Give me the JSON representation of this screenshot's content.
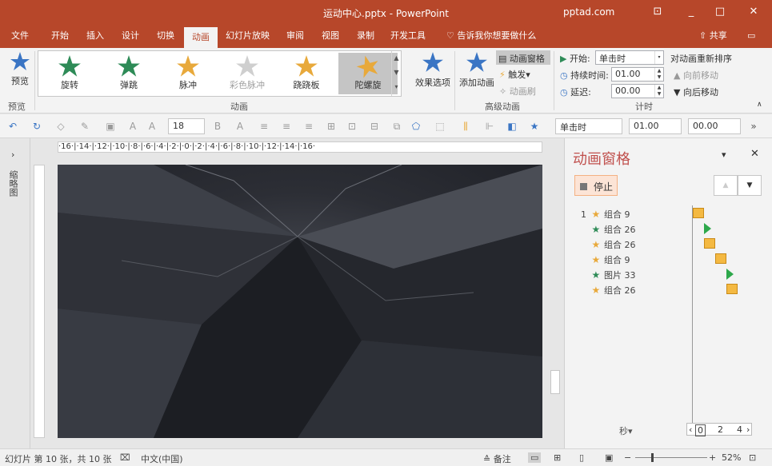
{
  "window": {
    "title": "运动中心.pptx - PowerPoint",
    "brand": "pptad.com",
    "minimize": "_",
    "maximize": "□",
    "close": "✕"
  },
  "tabs": [
    {
      "label": "文件"
    },
    {
      "label": "开始"
    },
    {
      "label": "插入"
    },
    {
      "label": "设计"
    },
    {
      "label": "切换"
    },
    {
      "label": "动画"
    },
    {
      "label": "幻灯片放映"
    },
    {
      "label": "审阅"
    },
    {
      "label": "视图"
    },
    {
      "label": "录制"
    },
    {
      "label": "开发工具"
    },
    {
      "label": "告诉我你想要做什么"
    }
  ],
  "share_label": "共享",
  "ribbon": {
    "preview_label": "预览",
    "preview_group": "预览",
    "animations": [
      {
        "label": "旋转",
        "color": "#2e8b57"
      },
      {
        "label": "弹跳",
        "color": "#2e8b57"
      },
      {
        "label": "脉冲",
        "color": "#e8a93b"
      },
      {
        "label": "彩色脉冲",
        "color": "#c8c8c8"
      },
      {
        "label": "跷跷板",
        "color": "#e8a93b"
      },
      {
        "label": "陀螺旋",
        "color": "#e8a93b"
      }
    ],
    "animation_group": "动画",
    "effect_options": "效果选项",
    "add_animation": "添加动画",
    "animation_pane": "动画窗格",
    "trigger": "触发",
    "animation_painter": "动画刷",
    "advanced_group": "高级动画",
    "start_label": "开始:",
    "start_value": "单击时",
    "duration_label": "持续时间:",
    "duration_value": "01.00",
    "delay_label": "延迟:",
    "delay_value": "00.00",
    "timing_group": "计时",
    "reorder_label": "对动画重新排序",
    "move_earlier": "向前移动",
    "move_later": "向后移动"
  },
  "toolbar2": {
    "font_size": "18",
    "start_value": "单击时",
    "duration_value": "01.00",
    "delay_value": "00.00"
  },
  "thumbnails_label": "缩略图",
  "ruler": {
    "h_labels": "·16·|·14·|·12·|·10·|·8·|·6·|·4·|·2·|·0·|·2·|·4·|·6·|·8·|·10·|·12·|·14·|·16·"
  },
  "animation_pane": {
    "title": "动画窗格",
    "stop": "停止",
    "items": [
      {
        "num": "1",
        "name": "组合 9",
        "color": "#e8a93b"
      },
      {
        "num": "",
        "name": "组合 26",
        "color": "#2e8b57"
      },
      {
        "num": "",
        "name": "组合 26",
        "color": "#e8a93b"
      },
      {
        "num": "",
        "name": "组合 9",
        "color": "#e8a93b"
      },
      {
        "num": "",
        "name": "图片 33",
        "color": "#2e8b57"
      },
      {
        "num": "",
        "name": "组合 26",
        "color": "#e8a93b"
      }
    ],
    "seconds": "秒",
    "scale": [
      "0",
      "2",
      "4"
    ]
  },
  "status": {
    "slide_info": "幻灯片 第 10 张，共 10 张",
    "language": "中文(中国)",
    "notes": "备注",
    "zoom": "52%"
  }
}
